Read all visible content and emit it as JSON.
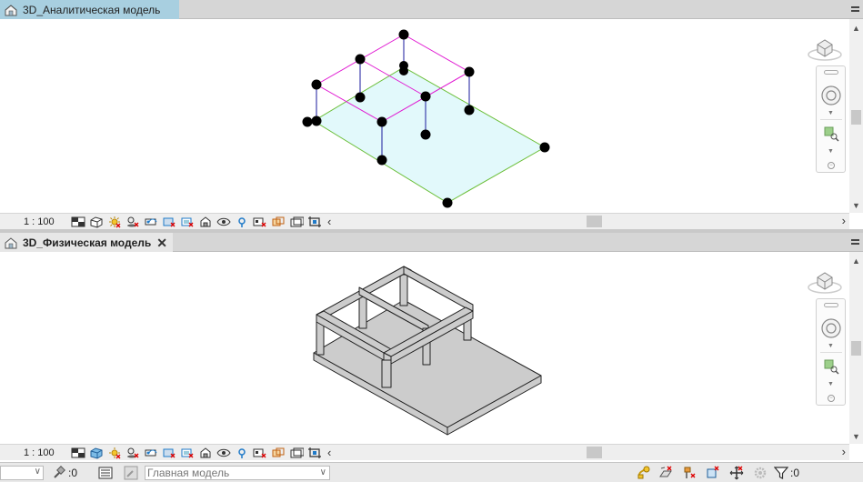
{
  "top_view": {
    "tab_title": "3D_Аналитическая модель",
    "scale": "1 : 100"
  },
  "bottom_view": {
    "tab_title": "3D_Физическая модель",
    "close_glyph": "✕",
    "scale": "1 : 100"
  },
  "status_bar": {
    "selection_count": ":0",
    "workset_placeholder": "Главная модель",
    "filter_count": ":0"
  },
  "colors": {
    "accent_tab": "#a8cfe0",
    "analytical_slab_fill": "#e2f9fb",
    "analytical_beam": "#e01ad2",
    "analytical_column": "#1a1a9e",
    "slab_edge": "#6cbf3a",
    "node": "#000000",
    "physical_fill": "#cccccc"
  },
  "icons": {
    "view_control_bar": [
      "detail-level-icon",
      "visual-style-icon",
      "sun-path-icon",
      "shadows-icon",
      "render-icon",
      "crop-view-icon",
      "show-crop-icon",
      "unlock-3d-icon",
      "temporary-hide-icon",
      "reveal-hidden-icon",
      "analytical-model-icon",
      "highlight-displacement-icon",
      "reveal-constraints-icon",
      "worksharing-display-icon",
      "crop-region-icon"
    ],
    "status_bar": [
      "press-drag-icon",
      "select-links-icon",
      "select-underlay-icon",
      "select-pinned-icon",
      "select-by-face-icon",
      "drag-on-selection-icon",
      "background-processes-icon",
      "filter-icon"
    ]
  }
}
